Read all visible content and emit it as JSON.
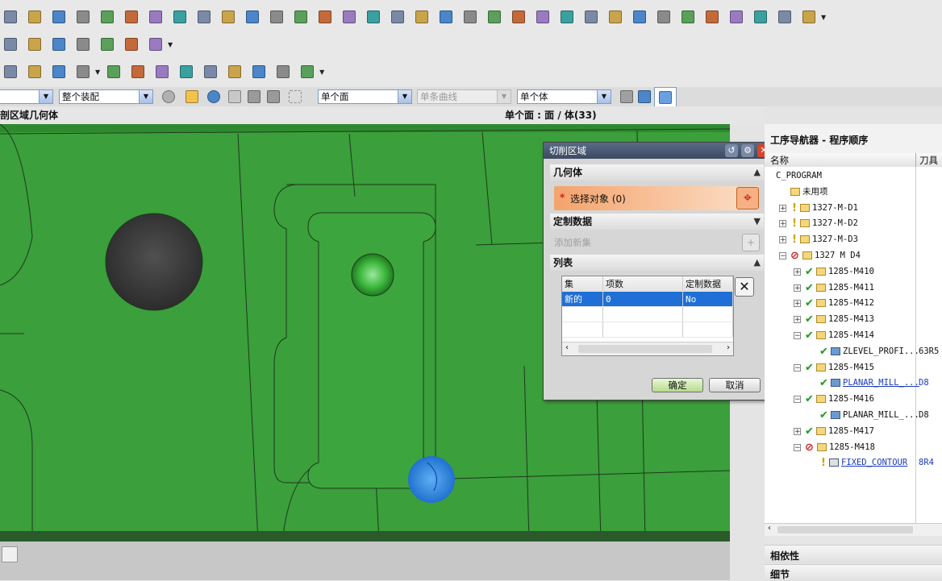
{
  "toolbar": {
    "row1_icons": [
      "extrude-icon",
      "revolve-icon",
      "hole-icon",
      "boss-icon",
      "pocket-icon",
      "edge-blend-icon",
      "chamfer-icon",
      "trim-body-icon",
      "shell-icon",
      "draft-icon",
      "offset-face-icon",
      "sew-icon",
      "curve-icon",
      "analysis-icon",
      "generate-toolpath-icon",
      "postprocess-icon",
      "shop-doc-icon",
      "list-icon",
      "verify-icon",
      "gouge-check-icon",
      "display-icon",
      "measure-icon",
      "layer-icon",
      "section-icon",
      "wcs-icon",
      "toolpath-icon",
      "check-icon",
      "box-icon",
      "stock-icon",
      "knife-icon",
      "text-icon",
      "blend-icon",
      "grid-icon",
      "magic-icon"
    ],
    "row2_icons": [
      "punch-icon",
      "die-icon",
      "cube-icon",
      "layout-icon",
      "report-icon",
      "moon-icon",
      "tool-table-icon"
    ],
    "row3_icons": [
      "group-icon",
      "layers-icon",
      "expand-icon",
      "collapse-icon",
      "filter-icon",
      "seq-icon",
      "up-icon",
      "down-icon",
      "level1-icon",
      "level2-icon",
      "level3-icon",
      "level4-icon",
      "level5-icon"
    ]
  },
  "selbar": {
    "filter1": "",
    "filter2": "整个装配",
    "filter3": "单个面",
    "filter4": "单条曲线",
    "filter5": "单个体"
  },
  "info": {
    "left": "剖区域几何体",
    "center": "单个面 : 面 / 体(33)"
  },
  "dialog": {
    "title": "切削区域",
    "geometry_header": "几何体",
    "required_mark": "*",
    "select_object": "选择对象 (0)",
    "custom_data_header": "定制数据",
    "add_new_set": "添加新集",
    "list_header": "列表",
    "columns": [
      "集",
      "项数",
      "定制数据"
    ],
    "rows": [
      [
        "新的",
        "0",
        "No"
      ]
    ],
    "ok": "确定",
    "cancel": "取消"
  },
  "navigator": {
    "title": "工序导航器 - 程序顺序",
    "col_name": "名称",
    "col_tool": "刀具",
    "items": [
      {
        "name": "C_PROGRAM",
        "tool": "",
        "status": "none",
        "indent": 0,
        "expand": "",
        "folder": false
      },
      {
        "name": "未用项",
        "tool": "",
        "status": "none",
        "indent": 1,
        "expand": "",
        "folder": true
      },
      {
        "name": "1327-M-D1",
        "tool": "",
        "status": "pending",
        "indent": 1,
        "expand": "+",
        "folder": true
      },
      {
        "name": "1327-M-D2",
        "tool": "",
        "status": "pending",
        "indent": 1,
        "expand": "+",
        "folder": true
      },
      {
        "name": "1327-M-D3",
        "tool": "",
        "status": "pending",
        "indent": 1,
        "expand": "+",
        "folder": true
      },
      {
        "name": "1327 M D4",
        "tool": "",
        "status": "error",
        "indent": 1,
        "expand": "-",
        "folder": true
      },
      {
        "name": "1285-M410",
        "tool": "",
        "status": "done",
        "indent": 2,
        "expand": "+",
        "folder": true
      },
      {
        "name": "1285-M411",
        "tool": "",
        "status": "done",
        "indent": 2,
        "expand": "+",
        "folder": true
      },
      {
        "name": "1285-M412",
        "tool": "",
        "status": "done",
        "indent": 2,
        "expand": "+",
        "folder": true
      },
      {
        "name": "1285-M413",
        "tool": "",
        "status": "done",
        "indent": 2,
        "expand": "+",
        "folder": true
      },
      {
        "name": "1285-M414",
        "tool": "",
        "status": "done",
        "indent": 2,
        "expand": "-",
        "folder": true
      },
      {
        "name": "ZLEVEL_PROFI...",
        "tool": "63R5",
        "status": "done",
        "indent": 3,
        "expand": "",
        "folder": false,
        "op": "zlevel"
      },
      {
        "name": "1285-M415",
        "tool": "",
        "status": "done",
        "indent": 2,
        "expand": "-",
        "folder": true
      },
      {
        "name": "PLANAR_MILL_...",
        "tool": "D8",
        "status": "done",
        "indent": 3,
        "expand": "",
        "folder": false,
        "op": "planar",
        "link": true
      },
      {
        "name": "1285-M416",
        "tool": "",
        "status": "done",
        "indent": 2,
        "expand": "-",
        "folder": true
      },
      {
        "name": "PLANAR_MILL_...",
        "tool": "D8",
        "status": "done",
        "indent": 3,
        "expand": "",
        "folder": false,
        "op": "planar"
      },
      {
        "name": "1285-M417",
        "tool": "",
        "status": "done",
        "indent": 2,
        "expand": "+",
        "folder": true
      },
      {
        "name": "1285-M418",
        "tool": "",
        "status": "error",
        "indent": 2,
        "expand": "-",
        "folder": true
      },
      {
        "name": "FIXED_CONTOUR",
        "tool": "8R4",
        "status": "pending",
        "indent": 3,
        "expand": "",
        "folder": false,
        "op": "contour",
        "link": true
      }
    ],
    "dependencies": "相依性",
    "details": "细节"
  },
  "colors": {
    "part_green": "#3a9e3a",
    "selection_blue": "#1f6fd6",
    "dialog_highlight": "#f4a36c",
    "check_green": "#1a9a1a",
    "error_red": "#d01818"
  }
}
